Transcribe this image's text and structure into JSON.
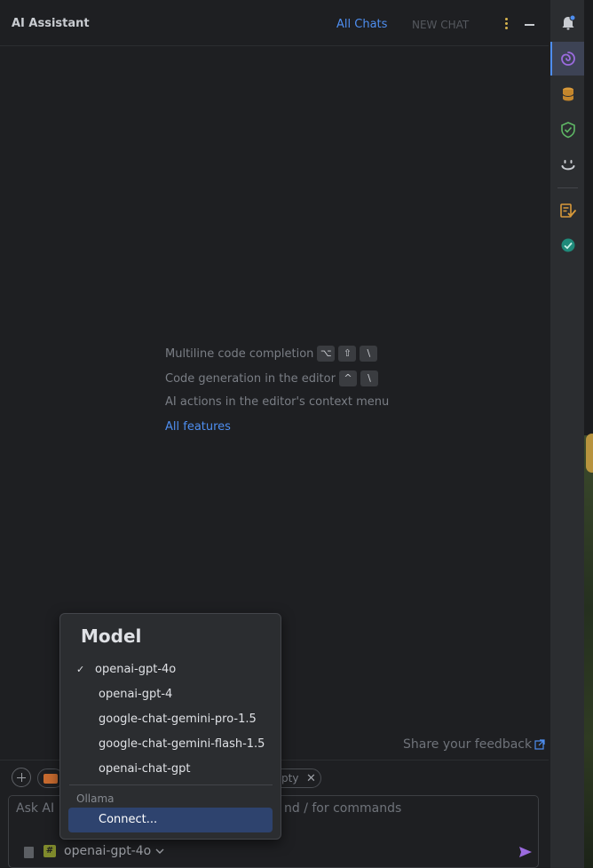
{
  "header": {
    "title": "AI Assistant",
    "all_chats": "All Chats",
    "new_chat": "NEW CHAT"
  },
  "hints": [
    {
      "label": "Multiline code completion",
      "keys": [
        "⌥",
        "⇧",
        "\\"
      ]
    },
    {
      "label": "Code generation in the editor",
      "keys": [
        "^",
        "\\"
      ]
    },
    {
      "label": "AI actions in the editor's context menu",
      "keys": []
    }
  ],
  "all_features": "All features",
  "feedback": "Share your feedback",
  "input": {
    "chip_text": "pty",
    "placeholder_left": "Ask AI",
    "placeholder_right": "nd / for commands",
    "model_selected": "openai-gpt-4o"
  },
  "model_popup": {
    "title": "Model",
    "check_mark": "✓",
    "options": [
      "openai-gpt-4o",
      "openai-gpt-4",
      "google-chat-gemini-pro-1.5",
      "google-chat-gemini-flash-1.5",
      "openai-chat-gpt"
    ],
    "selected_index": 0,
    "section_label": "Ollama",
    "connect_label": "Connect..."
  },
  "toolstrip": [
    "bell-icon",
    "ai-assistant-icon",
    "database-icon",
    "shield-check-icon",
    "smile-icon",
    "checklist-icon",
    "check-circle-icon"
  ],
  "colors": {
    "background": "#1e1f22",
    "link": "#4e8ef0",
    "selection": "#2e436e",
    "accent_purple": "#9b6bdf"
  }
}
